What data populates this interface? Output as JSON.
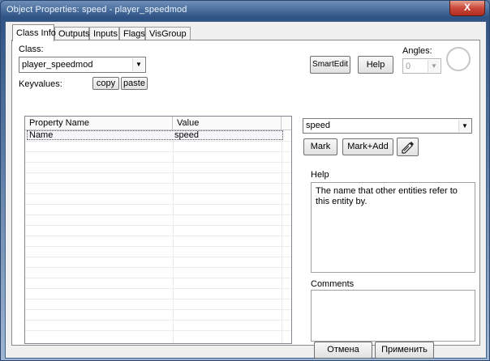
{
  "window": {
    "title": "Object Properties: speed - player_speedmod",
    "close_glyph": "X"
  },
  "tabs": [
    {
      "label": "Class Info",
      "active": true
    },
    {
      "label": "Outputs",
      "active": false
    },
    {
      "label": "Inputs",
      "active": false
    },
    {
      "label": "Flags",
      "active": false
    },
    {
      "label": "VisGroup",
      "active": false
    }
  ],
  "class_info": {
    "class_label": "Class:",
    "class_value": "player_speedmod",
    "keyvalues_label": "Keyvalues:",
    "copy_label": "copy",
    "paste_label": "paste",
    "smartedit_label": "SmartEdit",
    "help_button_label": "Help",
    "angles_label": "Angles:",
    "angles_value": "0",
    "table": {
      "columns": [
        "Property Name",
        "Value"
      ],
      "rows": [
        {
          "name": "Name",
          "value": "speed"
        }
      ]
    },
    "value_combo": "speed",
    "mark_label": "Mark",
    "mark_add_label": "Mark+Add",
    "eyedropper_icon": "eyedropper-icon",
    "help_group_label": "Help",
    "help_text": "The name that other entities refer to this entity by.",
    "comments_label": "Comments",
    "comments_text": ""
  },
  "footer": {
    "cancel_label": "Отмена",
    "apply_label": "Применить"
  }
}
